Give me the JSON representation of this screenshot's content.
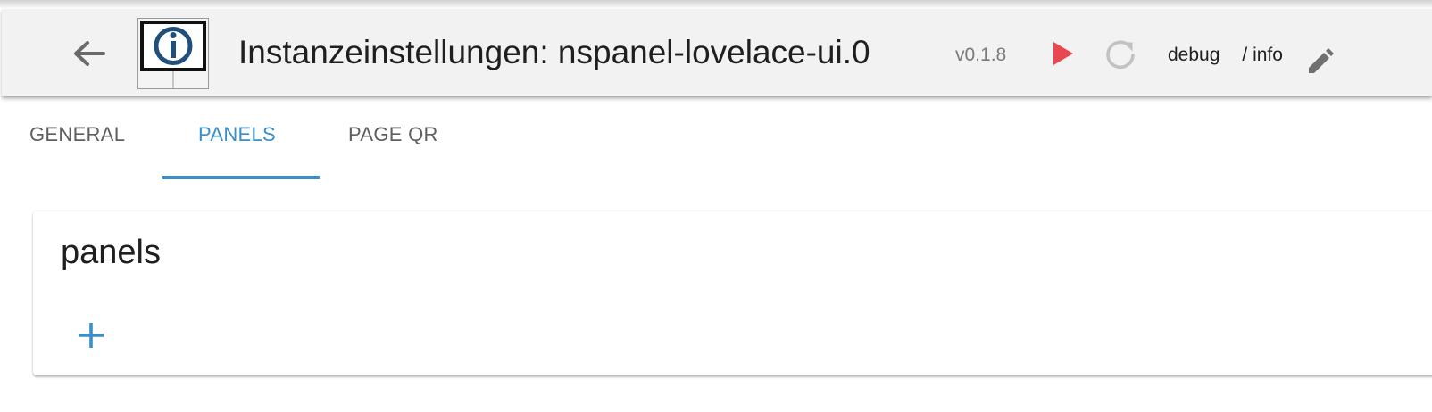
{
  "header": {
    "title": "Instanzeinstellungen: nspanel-lovelace-ui.0",
    "version": "v0.1.8",
    "log_level_current": "debug",
    "log_level_separator": "/ info",
    "back_icon": "arrow-left-icon",
    "logo_icon": "iobroker-logo-icon",
    "play_icon": "play-icon",
    "reload_icon": "reload-icon",
    "edit_icon": "pencil-icon"
  },
  "tabs": [
    {
      "label": "GENERAL",
      "active": false
    },
    {
      "label": "PANELS",
      "active": true
    },
    {
      "label": "PAGE QR",
      "active": false
    }
  ],
  "card": {
    "title": "panels",
    "add_icon": "plus-icon"
  },
  "colors": {
    "accent": "#3a8fc7",
    "play": "#e8484f",
    "header_bg": "#f2f2f2",
    "logo_blue": "#1f4f7a"
  }
}
